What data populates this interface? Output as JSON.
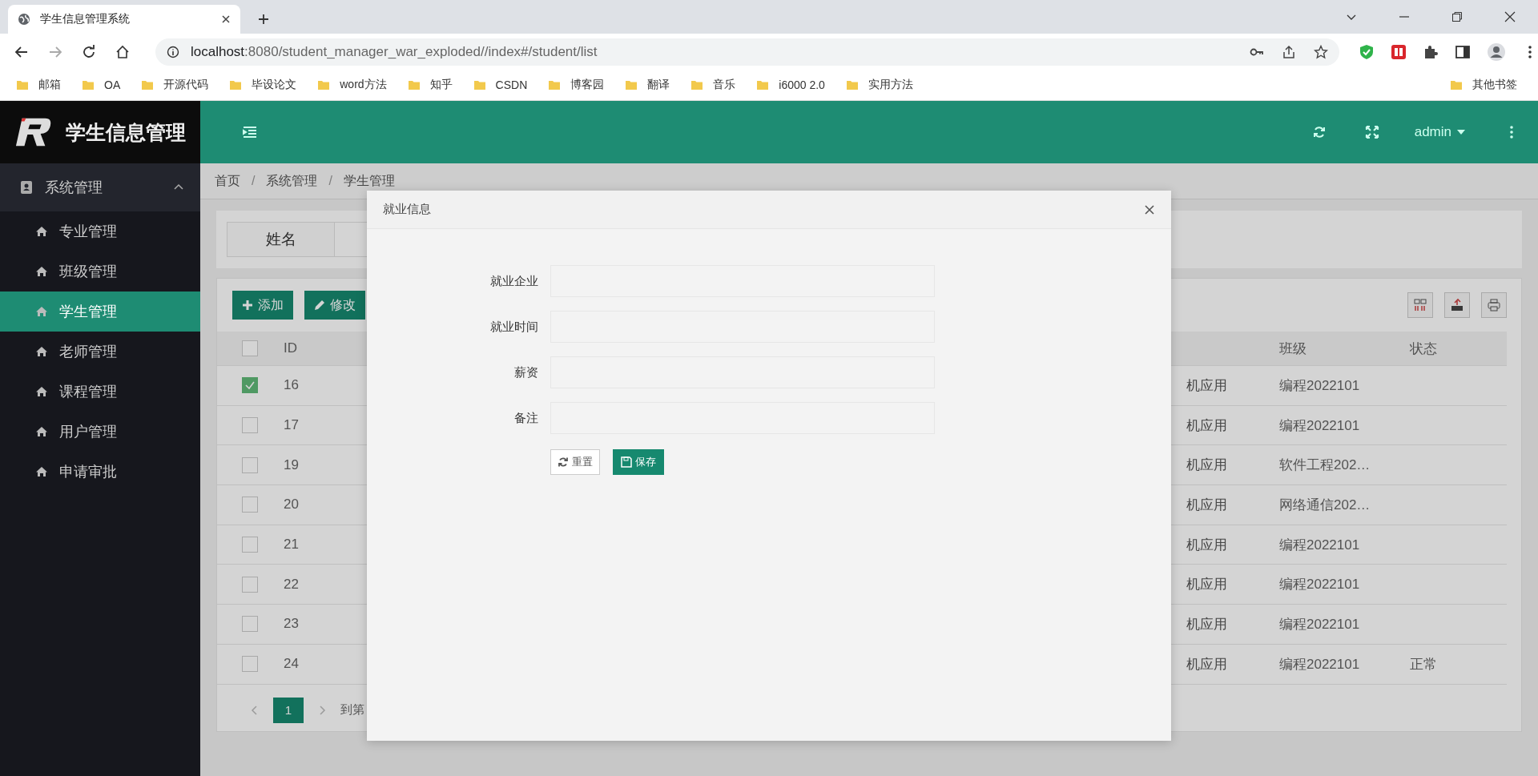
{
  "browser": {
    "tab_title": "学生信息管理系统",
    "url_host": "localhost",
    "url_rest": ":8080/student_manager_war_exploded//index#/student/list",
    "bookmarks": [
      "邮箱",
      "OA",
      "开源代码",
      "毕设论文",
      "word方法",
      "知乎",
      "CSDN",
      "博客园",
      "翻译",
      "音乐",
      "i6000 2.0",
      "实用方法"
    ],
    "other_bookmarks": "其他书签"
  },
  "logo_text": "学生信息管理",
  "sidebar": {
    "groups": [
      {
        "label": "系统管理",
        "expanded": true,
        "items": [
          {
            "label": "专业管理",
            "selected": false
          },
          {
            "label": "班级管理",
            "selected": false
          },
          {
            "label": "学生管理",
            "selected": true
          },
          {
            "label": "老师管理",
            "selected": false
          },
          {
            "label": "课程管理",
            "selected": false
          },
          {
            "label": "用户管理",
            "selected": false
          },
          {
            "label": "申请审批",
            "selected": false
          }
        ]
      }
    ]
  },
  "header": {
    "user": "admin"
  },
  "breadcrumb": [
    {
      "label": "首页"
    },
    {
      "separator": "/",
      "label": "系统管理"
    },
    {
      "separator": "/",
      "label": "学生管理"
    }
  ],
  "search": {
    "label": "姓名"
  },
  "toolbar": [
    {
      "label": "添加",
      "kind": "add"
    },
    {
      "label": "修改",
      "kind": "edit"
    }
  ],
  "table": {
    "all_checked": false,
    "columns": [
      "ID",
      "班级",
      "状态"
    ],
    "rows": [
      {
        "selected": true,
        "id": "16",
        "major": "机应用",
        "class": "编程2022101",
        "status": ""
      },
      {
        "selected": false,
        "id": "17",
        "major": "机应用",
        "class": "编程2022101",
        "status": ""
      },
      {
        "selected": false,
        "id": "19",
        "major": "机应用",
        "class": "软件工程202…",
        "status": ""
      },
      {
        "selected": false,
        "id": "20",
        "major": "机应用",
        "class": "网络通信202…",
        "status": ""
      },
      {
        "selected": false,
        "id": "21",
        "major": "机应用",
        "class": "编程2022101",
        "status": ""
      },
      {
        "selected": false,
        "id": "22",
        "major": "机应用",
        "class": "编程2022101",
        "status": ""
      },
      {
        "selected": false,
        "id": "23",
        "major": "机应用",
        "class": "编程2022101",
        "status": ""
      },
      {
        "selected": false,
        "id": "24",
        "major": "机应用",
        "class": "编程2022101",
        "status": "正常"
      }
    ]
  },
  "pagination": {
    "pages": [
      {
        "label": "1",
        "selected": true
      }
    ],
    "goto_label": "到第"
  },
  "modal": {
    "title": "就业信息",
    "fields": [
      {
        "label": "就业企业"
      },
      {
        "label": "就业时间"
      },
      {
        "label": "薪资"
      },
      {
        "label": "备注"
      }
    ],
    "reset": "重置",
    "save": "保存"
  }
}
